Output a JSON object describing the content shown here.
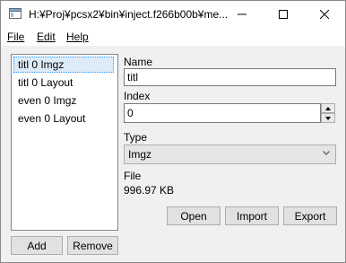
{
  "window": {
    "title": "H:¥Proj¥pcsx2¥bin¥inject.f266b00b¥me..."
  },
  "icons": {
    "app": "window-app-icon",
    "minimize": "minimize-icon",
    "maximize": "maximize-icon",
    "close": "close-icon",
    "spin_up": "chevron-up-icon",
    "spin_down": "chevron-down-icon",
    "combo": "chevron-down-icon"
  },
  "menu": {
    "file": "File",
    "edit": "Edit",
    "help": "Help"
  },
  "list": {
    "items": [
      "titl 0 Imgz",
      "titl 0 Layout",
      "even 0 Imgz",
      "even 0 Layout"
    ],
    "selected_index": 0
  },
  "fields": {
    "name_label": "Name",
    "name_value": "titl",
    "index_label": "Index",
    "index_value": "0",
    "type_label": "Type",
    "type_value": "Imgz",
    "file_label": "File",
    "file_value": "996.97 KB"
  },
  "buttons": {
    "open": "Open",
    "import": "Import",
    "export": "Export",
    "add": "Add",
    "remove": "Remove"
  },
  "colors": {
    "selection_bg": "#dcebf7",
    "selection_border": "#3399ff"
  }
}
